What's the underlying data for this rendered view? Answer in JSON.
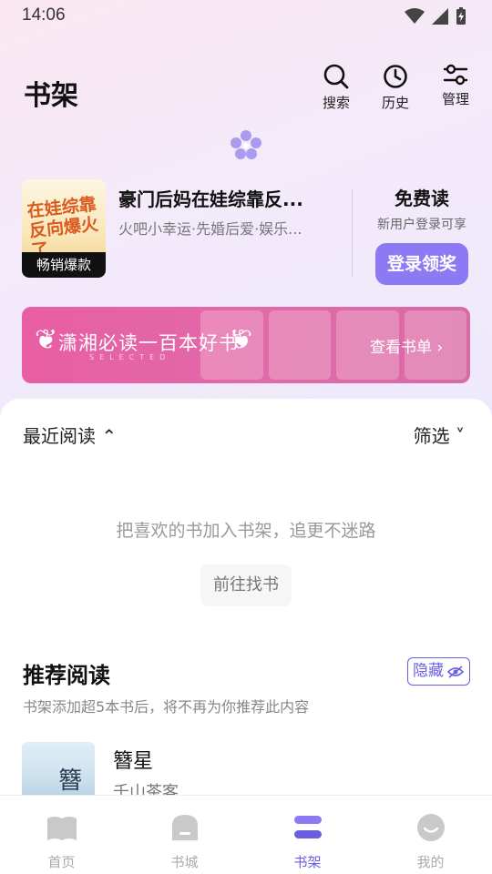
{
  "status_bar": {
    "time": "14:06"
  },
  "header": {
    "title": "书架",
    "search_label": "搜索",
    "history_label": "历史",
    "manage_label": "管理"
  },
  "promo": {
    "cover_title": "在娃综靠反向爆火了",
    "cover_badge": "畅销爆款",
    "book_title": "豪门后妈在娃综靠反...",
    "book_tags": "火吧小幸运·先婚后爱·娱乐...",
    "free_title": "免费读",
    "free_subtitle": "新用户登录可享",
    "login_button": "登录领奖"
  },
  "banner": {
    "text": "潇湘必读一百本好书",
    "subtext": "SELECTED",
    "link": "查看书单 ›"
  },
  "shelf": {
    "sort_label": "最近阅读 ⌃",
    "filter_label": "筛选 ˅",
    "empty_text": "把喜欢的书加入书架，追更不迷路",
    "find_button": "前往找书"
  },
  "recommend": {
    "title": "推荐阅读",
    "hide_label": "隐藏",
    "subtitle": "书架添加超5本书后，将不再为你推荐此内容",
    "book": {
      "cover_char": "簪",
      "name": "簪星",
      "author": "千山茶客"
    }
  },
  "nav": {
    "home": "首页",
    "store": "书城",
    "shelf": "书架",
    "mine": "我的"
  },
  "colors": {
    "accent": "#6a5fe0",
    "login_button": "#8c7af5",
    "banner": "#e85ea4"
  }
}
